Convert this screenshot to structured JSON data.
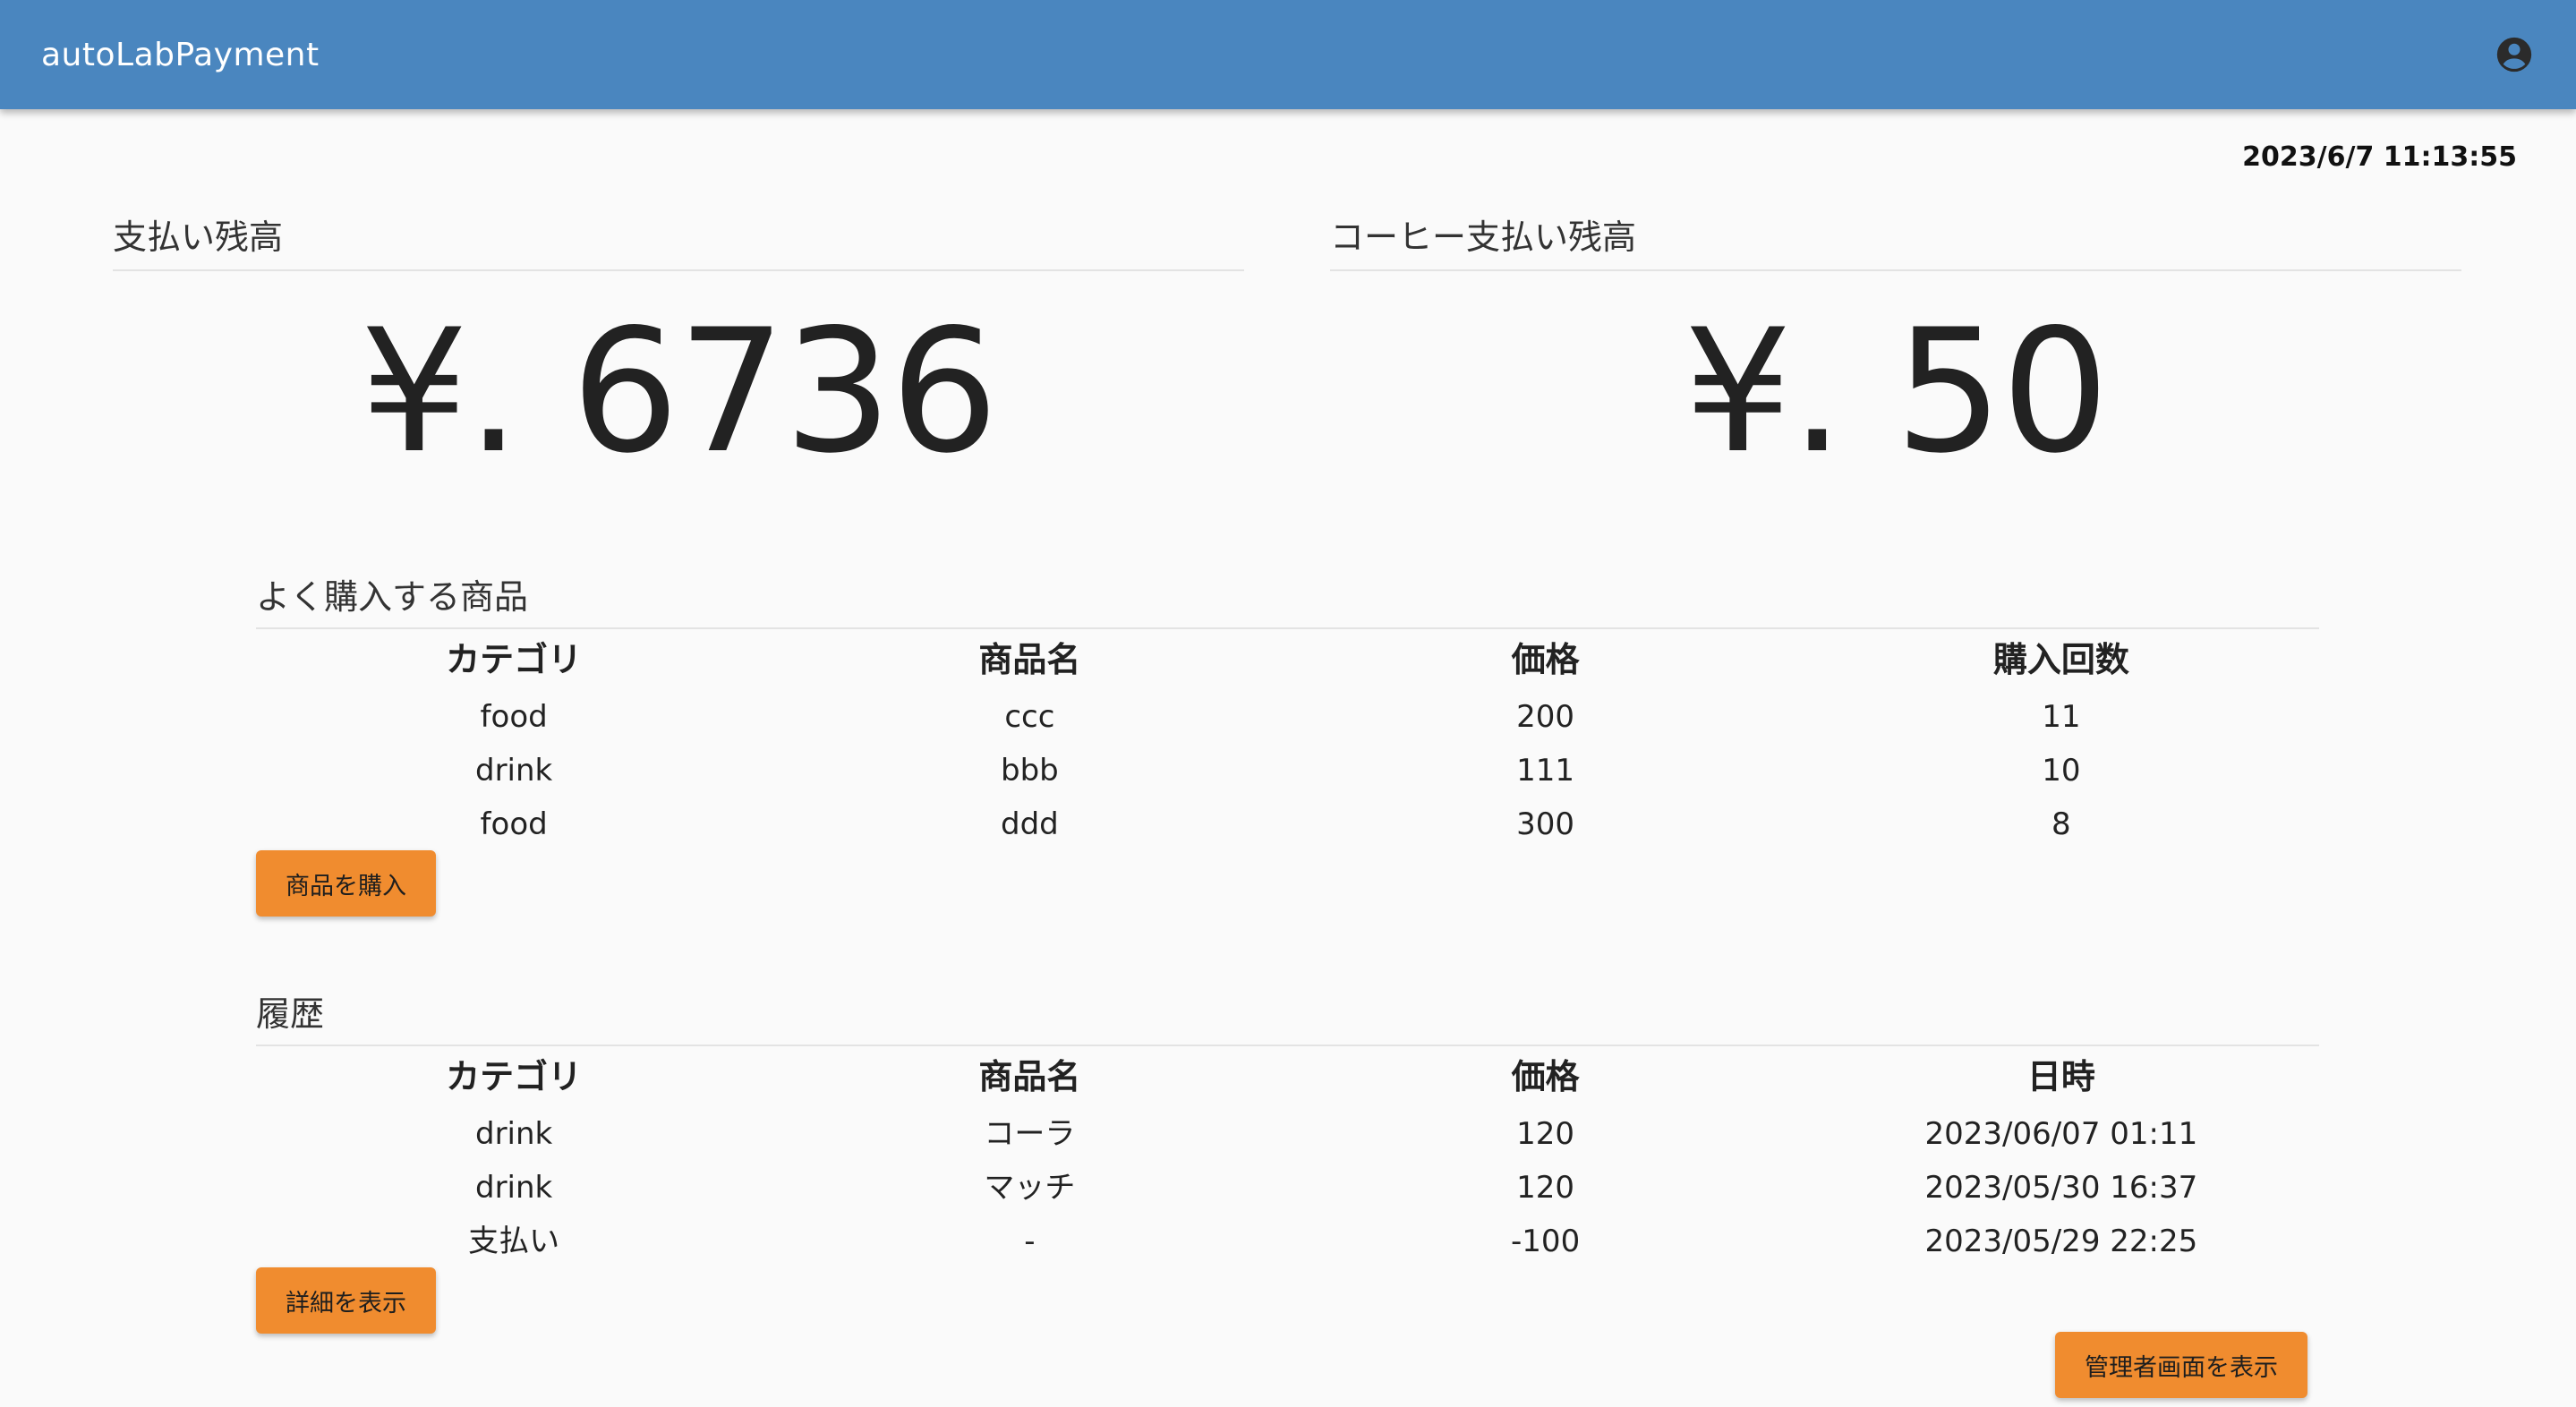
{
  "app": {
    "title": "autoLabPayment",
    "account_icon": "account-circle-icon",
    "colors": {
      "appbar": "#4a86bf",
      "button": "#f08c2f",
      "background": "#fafafa"
    }
  },
  "clock": "2023/6/7 11:13:55",
  "balances": {
    "payment": {
      "label": "支払い残高",
      "amount": "¥. 6736"
    },
    "coffee": {
      "label": "コーヒー支払い残高",
      "amount": "¥. 50"
    }
  },
  "popular": {
    "title": "よく購入する商品",
    "headers": [
      "カテゴリ",
      "商品名",
      "価格",
      "購入回数"
    ],
    "rows": [
      [
        "food",
        "ccc",
        "200",
        "11"
      ],
      [
        "drink",
        "bbb",
        "111",
        "10"
      ],
      [
        "food",
        "ddd",
        "300",
        "8"
      ]
    ],
    "button_label": "商品を購入"
  },
  "history": {
    "title": "履歴",
    "headers": [
      "カテゴリ",
      "商品名",
      "価格",
      "日時"
    ],
    "rows": [
      [
        "drink",
        "コーラ",
        "120",
        "2023/06/07 01:11"
      ],
      [
        "drink",
        "マッチ",
        "120",
        "2023/05/30 16:37"
      ],
      [
        "支払い",
        "-",
        "-100",
        "2023/05/29 22:25"
      ]
    ],
    "button_label": "詳細を表示"
  },
  "admin_button_label": "管理者画面を表示"
}
